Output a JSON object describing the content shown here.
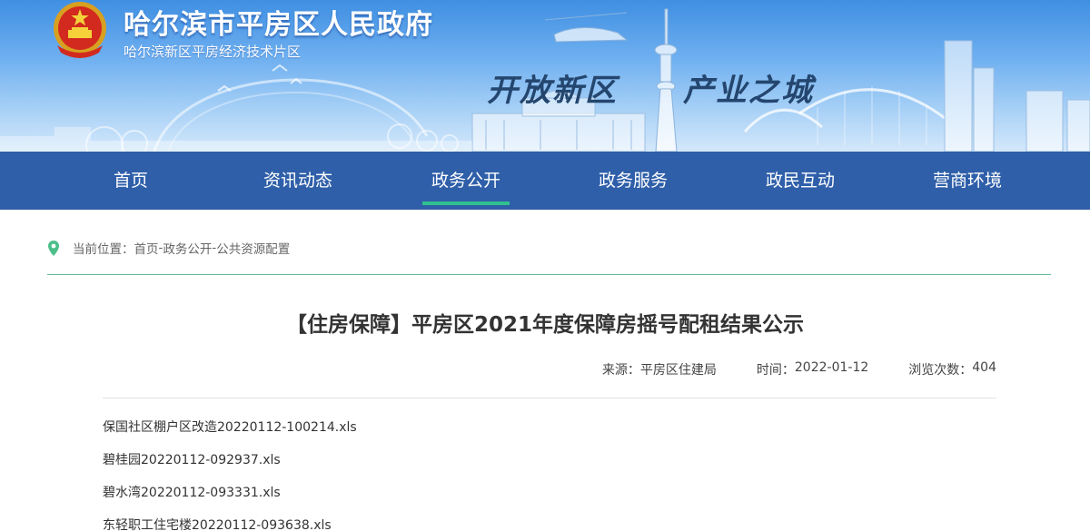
{
  "header": {
    "site_title": "哈尔滨市平房区人民政府",
    "site_subtitle": "哈尔滨新区平房经济技术片区",
    "slogan_left": "开放新区",
    "slogan_right": "产业之城",
    "emblem_icon": "national-emblem-icon"
  },
  "nav": {
    "items": [
      {
        "label": "首页"
      },
      {
        "label": "资讯动态"
      },
      {
        "label": "政务公开",
        "active": true
      },
      {
        "label": "政务服务"
      },
      {
        "label": "政民互动"
      },
      {
        "label": "营商环境"
      }
    ]
  },
  "breadcrumb": {
    "prefix": "当前位置：",
    "items": [
      "首页",
      "政务公开",
      "公共资源配置"
    ],
    "separator": "-",
    "icon": "location-pin-icon"
  },
  "article": {
    "title": "【住房保障】平房区2021年度保障房摇号配租结果公示",
    "source_label": "来源：",
    "source": "平房区住建局",
    "time_label": "时间：",
    "time": "2022-01-12",
    "views_label": "浏览次数：",
    "views": "404",
    "attachments": [
      "保国社区棚户区改造20220112-100214.xls",
      "碧桂园20220112-092937.xls",
      "碧水湾20220112-093331.xls",
      "东轻职工住宅楼20220112-093638.xls"
    ]
  },
  "colors": {
    "nav_bg": "#2f5fa9",
    "nav_active_underline": "#2fc28e",
    "divider_green": "#5cbf94",
    "banner_sky": "#6eaff0"
  }
}
